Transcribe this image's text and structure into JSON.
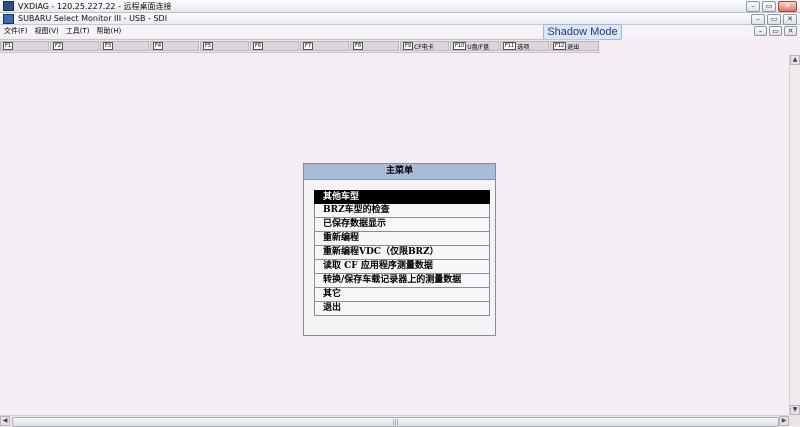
{
  "outer_window": {
    "title": "VXDIAG - 120.25.227.22 - 远程桌面连接",
    "buttons": {
      "minimize": "–",
      "restore": "▭",
      "close": "✕"
    }
  },
  "app_window": {
    "title": "SUBARU Select Monitor III - USB - SDI",
    "shadow_mode_label": "Shadow Mode"
  },
  "menubar": {
    "items": [
      "文件(F)",
      "视图(V)",
      "工具(T)",
      "帮助(H)"
    ]
  },
  "fkeys": [
    {
      "num": "F1",
      "label": ""
    },
    {
      "num": "F2",
      "label": ""
    },
    {
      "num": "F3",
      "label": ""
    },
    {
      "num": "F4",
      "label": ""
    },
    {
      "num": "F5",
      "label": ""
    },
    {
      "num": "F6",
      "label": ""
    },
    {
      "num": "F7",
      "label": ""
    },
    {
      "num": "F8",
      "label": ""
    },
    {
      "num": "F9",
      "label": "CF电卡"
    },
    {
      "num": "F10",
      "label": "U盘/F盘"
    },
    {
      "num": "F11",
      "label": "选项"
    },
    {
      "num": "F12",
      "label": "退出"
    }
  ],
  "main_menu": {
    "title": "主菜单",
    "items": [
      "其他车型",
      "BRZ车型的检查",
      "已保存数据显示",
      "重新编程",
      "重新编程VDC（仅限BRZ）",
      "读取 CF 应用程序测量数据",
      "转换/保存车载记录器上的测量数据",
      "其它",
      "退出"
    ],
    "selected_index": 0
  },
  "scrollbar": {
    "up": "▲",
    "down": "▼",
    "left": "◀",
    "right": "▶",
    "grip": "|||"
  }
}
